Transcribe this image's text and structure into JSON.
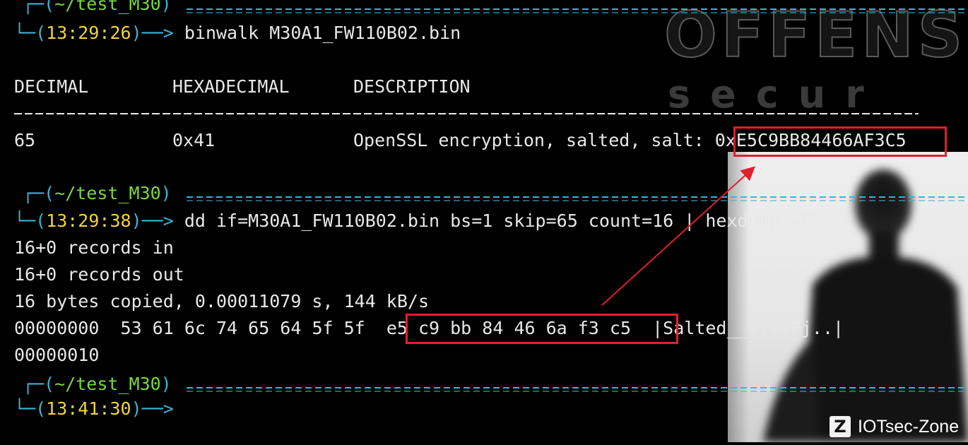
{
  "wallpaper": {
    "logo_text": "OFFENSE",
    "logo_sub": "secur",
    "watermark": "IOTsec-Zone",
    "watermark_icon": "zone-logo-icon"
  },
  "colors": {
    "frame": "#3ab4d6",
    "path": "#79d73e",
    "time": "#f3d43b",
    "highlight": "#e0202b"
  },
  "blocks": [
    {
      "prompt": {
        "path": "~/test_M30",
        "time": "13:29:26",
        "command": "binwalk M30A1_FW110B02.bin"
      }
    },
    {
      "prompt": {
        "path": "~/test_M30",
        "time": "13:29:38",
        "command": "dd if=M30A1_FW110B02.bin bs=1 skip=65 count=16 | hexdump -C"
      }
    },
    {
      "prompt": {
        "path": "~/test_M30",
        "time": "13:41:30",
        "command": ""
      }
    }
  ],
  "binwalk": {
    "headers": [
      "DECIMAL",
      "HEXADECIMAL",
      "DESCRIPTION"
    ],
    "row": {
      "decimal": "65",
      "hexadecimal": "0x41",
      "description": "OpenSSL encryption, salted, salt: ",
      "salt": "0xE5C9BB84466AF3C5"
    }
  },
  "dd_output": {
    "line1": "16+0 records in",
    "line2": "16+0 records out",
    "line3": "16 bytes copied, 0.00011079 s, 144 kB/s",
    "hex_offset": "00000000",
    "hex_bytes_a": "53 61 6c 74 65 64 5f 5f",
    "hex_bytes_b": "e5 c9 bb 84 46 6a f3 c5",
    "hex_ascii": "|Salted__....Fj..|",
    "end_offset": "00000010"
  }
}
